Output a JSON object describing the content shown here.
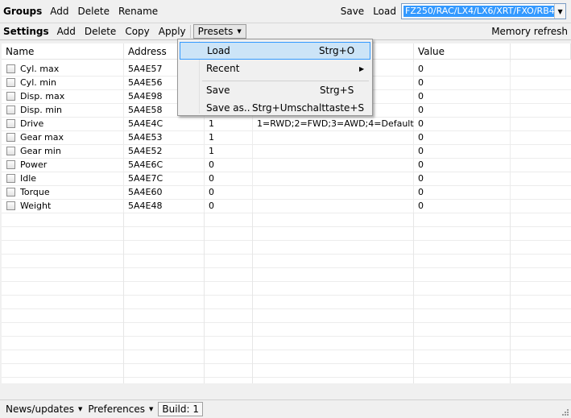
{
  "groups_bar": {
    "title": "Groups",
    "add": "Add",
    "delete": "Delete",
    "rename": "Rename",
    "save": "Save",
    "load": "Load",
    "combo_value": "FZ250/RAC/LX4/LX6/XRT/FXO/RB4"
  },
  "settings_bar": {
    "title": "Settings",
    "add": "Add",
    "delete": "Delete",
    "copy": "Copy",
    "apply": "Apply",
    "presets": "Presets",
    "memory_refresh": "Memory refresh"
  },
  "table": {
    "headers": [
      "Name",
      "Address",
      "",
      "",
      "Value"
    ],
    "rows": [
      {
        "name": "Cyl. max",
        "address": "5A4E57",
        "v1": "",
        "desc": "",
        "value": "0"
      },
      {
        "name": "Cyl. min",
        "address": "5A4E56",
        "v1": "",
        "desc": "",
        "value": "0"
      },
      {
        "name": "Disp. max",
        "address": "5A4E98",
        "v1": "",
        "desc": "",
        "value": "0"
      },
      {
        "name": "Disp. min",
        "address": "5A4E58",
        "v1": "",
        "desc": "",
        "value": "0"
      },
      {
        "name": "Drive",
        "address": "5A4E4C",
        "v1": "1",
        "desc": "1=RWD;2=FWD;3=AWD;4=Default",
        "value": "0"
      },
      {
        "name": "Gear max",
        "address": "5A4E53",
        "v1": "1",
        "desc": "",
        "value": "0"
      },
      {
        "name": "Gear min",
        "address": "5A4E52",
        "v1": "1",
        "desc": "",
        "value": "0"
      },
      {
        "name": "Power",
        "address": "5A4E6C",
        "v1": "0",
        "desc": "",
        "value": "0"
      },
      {
        "name": "Idle",
        "address": "5A4E7C",
        "v1": "0",
        "desc": "",
        "value": "0"
      },
      {
        "name": "Torque",
        "address": "5A4E60",
        "v1": "0",
        "desc": "",
        "value": "0"
      },
      {
        "name": "Weight",
        "address": "5A4E48",
        "v1": "0",
        "desc": "",
        "value": "0"
      }
    ]
  },
  "presets_menu": {
    "load": "Load",
    "load_shortcut": "Strg+O",
    "recent": "Recent",
    "save": "Save",
    "save_shortcut": "Strg+S",
    "save_as": "Save as..",
    "save_as_shortcut": "Strg+Umschalttaste+S"
  },
  "status_bar": {
    "news": "News/updates",
    "preferences": "Preferences",
    "build": "Build: 1"
  },
  "colors": {
    "selection": "#3399ff",
    "menu_highlight": "#cce4f7"
  }
}
